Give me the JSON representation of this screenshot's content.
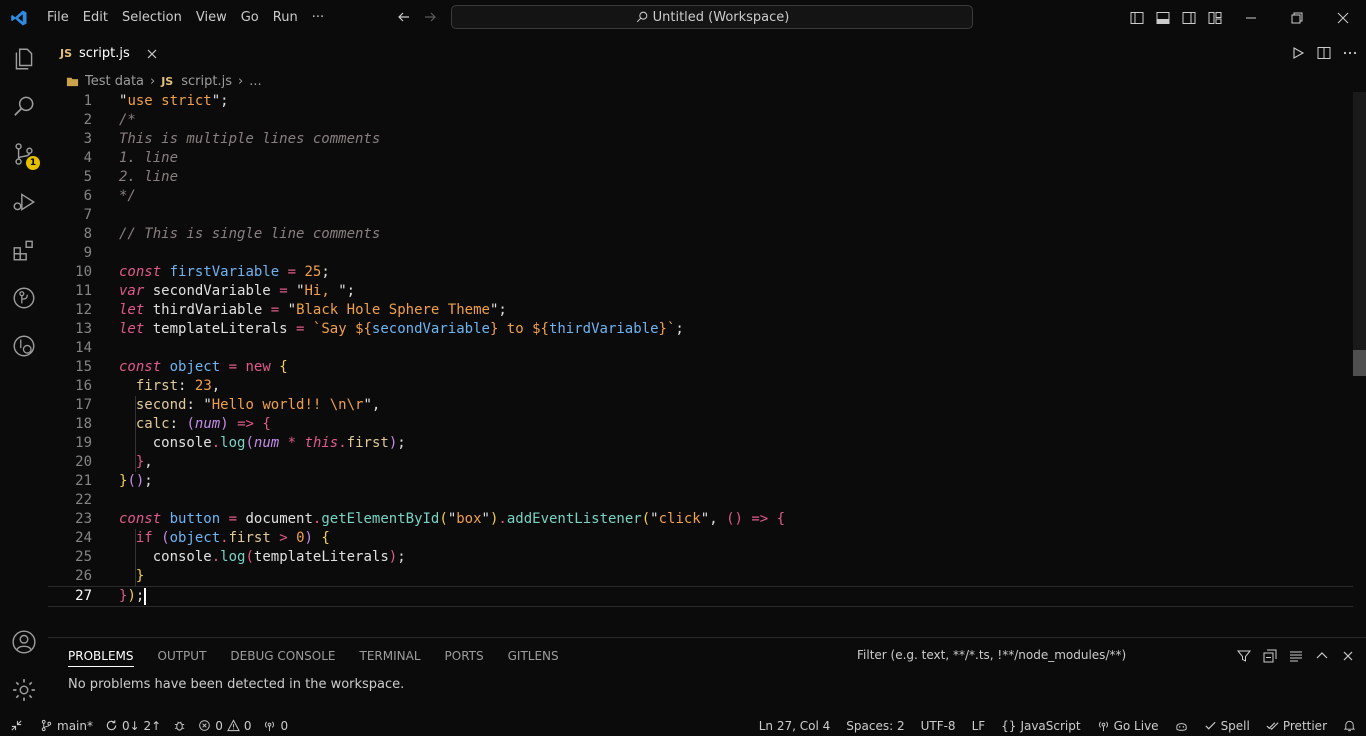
{
  "menu": [
    "File",
    "Edit",
    "Selection",
    "View",
    "Go",
    "Run",
    "···"
  ],
  "command_center": "Untitled (Workspace)",
  "activity": {
    "scm_badge": "1"
  },
  "tab": {
    "icon_text": "JS",
    "label": "script.js"
  },
  "breadcrumb": {
    "folder": "Test data",
    "file": "script.js",
    "more": "..."
  },
  "lines": [
    "1",
    "2",
    "3",
    "4",
    "5",
    "6",
    "7",
    "8",
    "9",
    "10",
    "11",
    "12",
    "13",
    "14",
    "15",
    "16",
    "17",
    "18",
    "19",
    "20",
    "21",
    "22",
    "23",
    "24",
    "25",
    "26",
    "27"
  ],
  "code": {
    "l1": {
      "q1": "\"",
      "s": "use strict",
      "q2": "\"",
      "e": ";"
    },
    "l2": "/*",
    "l3": "This is multiple lines comments",
    "l4": "1. line",
    "l5": "2. line",
    "l6": "*/",
    "l8": "// This is single line comments",
    "l10": {
      "k": "const",
      "v": "firstVariable",
      "o": "=",
      "n": "25",
      "e": ";"
    },
    "l11": {
      "k": "var",
      "v": "secondVariable",
      "o": "=",
      "q1": "\"",
      "s": "Hi, ",
      "q2": "\"",
      "e": ";"
    },
    "l12": {
      "k": "let",
      "v": "thirdVariable",
      "o": "=",
      "q1": "\"",
      "s": "Black Hole Sphere Theme",
      "q2": "\"",
      "e": ";"
    },
    "l13": {
      "k": "let",
      "v": "templateLiterals",
      "o": "=",
      "t1": "`Say ",
      "d1": "${",
      "v1": "secondVariable",
      "c1": "}",
      "t2": " to ",
      "d2": "${",
      "v2": "thirdVariable",
      "c2": "}",
      "t3": "`",
      "e": ";"
    },
    "l15": {
      "k": "const",
      "v": "object",
      "o": "=",
      "n": "new",
      "b": "{"
    },
    "l16": {
      "p": "first",
      "c": ":",
      "n": "23",
      "e": ","
    },
    "l17": {
      "p": "second",
      "c": ":",
      "q1": "\"",
      "s": "Hello world!! \\n\\r",
      "q2": "\"",
      "e": ","
    },
    "l18": {
      "p": "calc",
      "c": ":",
      "po": "(",
      "a": "num",
      "pc": ")",
      "arrow": "=>",
      "b": "{"
    },
    "l19": {
      "o": "console",
      "d": ".",
      "f": "log",
      "po": "(",
      "a": "num",
      "m": "*",
      "t": "this",
      "d2": ".",
      "p": "first",
      "pc": ")",
      "e": ";"
    },
    "l20": {
      "b": "}",
      "e": ","
    },
    "l21": {
      "b": "}",
      "pp": "()",
      "e": ";"
    },
    "l23": {
      "k": "const",
      "v": "button",
      "o": "=",
      "doc": "document",
      "d": ".",
      "f1": "getElementById",
      "po1": "(",
      "q1": "\"",
      "s1": "box",
      "q2": "\"",
      "pc1": ")",
      "d2": ".",
      "f2": "addEventListener",
      "po2": "(",
      "q3": "\"",
      "s2": "click",
      "q4": "\"",
      "cm": ",",
      "ar": "()",
      "arrow": "=>",
      "b": "{"
    },
    "l24": {
      "k": "if",
      "po": "(",
      "o": "object",
      "d": ".",
      "p": "first",
      "gt": ">",
      "n": "0",
      "pc": ")",
      "b": "{"
    },
    "l25": {
      "o": "console",
      "d": ".",
      "f": "log",
      "po": "(",
      "a": "templateLiterals",
      "pc": ")",
      "e": ";"
    },
    "l26": "}",
    "l27": {
      "b": "}",
      "pc": ")",
      "e": ";"
    }
  },
  "panel": {
    "tabs": [
      "PROBLEMS",
      "OUTPUT",
      "DEBUG CONSOLE",
      "TERMINAL",
      "PORTS",
      "GITLENS"
    ],
    "filter_placeholder": "Filter (e.g. text, **/*.ts, !**/node_modules/**)",
    "message": "No problems have been detected in the workspace."
  },
  "status": {
    "branch": "main*",
    "sync": "0↓ 2↑",
    "errors": "0",
    "warnings": "0",
    "ports": "0",
    "position": "Ln 27, Col 4",
    "spaces": "Spaces: 2",
    "encoding": "UTF-8",
    "eol": "LF",
    "language": "JavaScript",
    "golive": "Go Live",
    "spell": "Spell",
    "prettier": "Prettier"
  }
}
